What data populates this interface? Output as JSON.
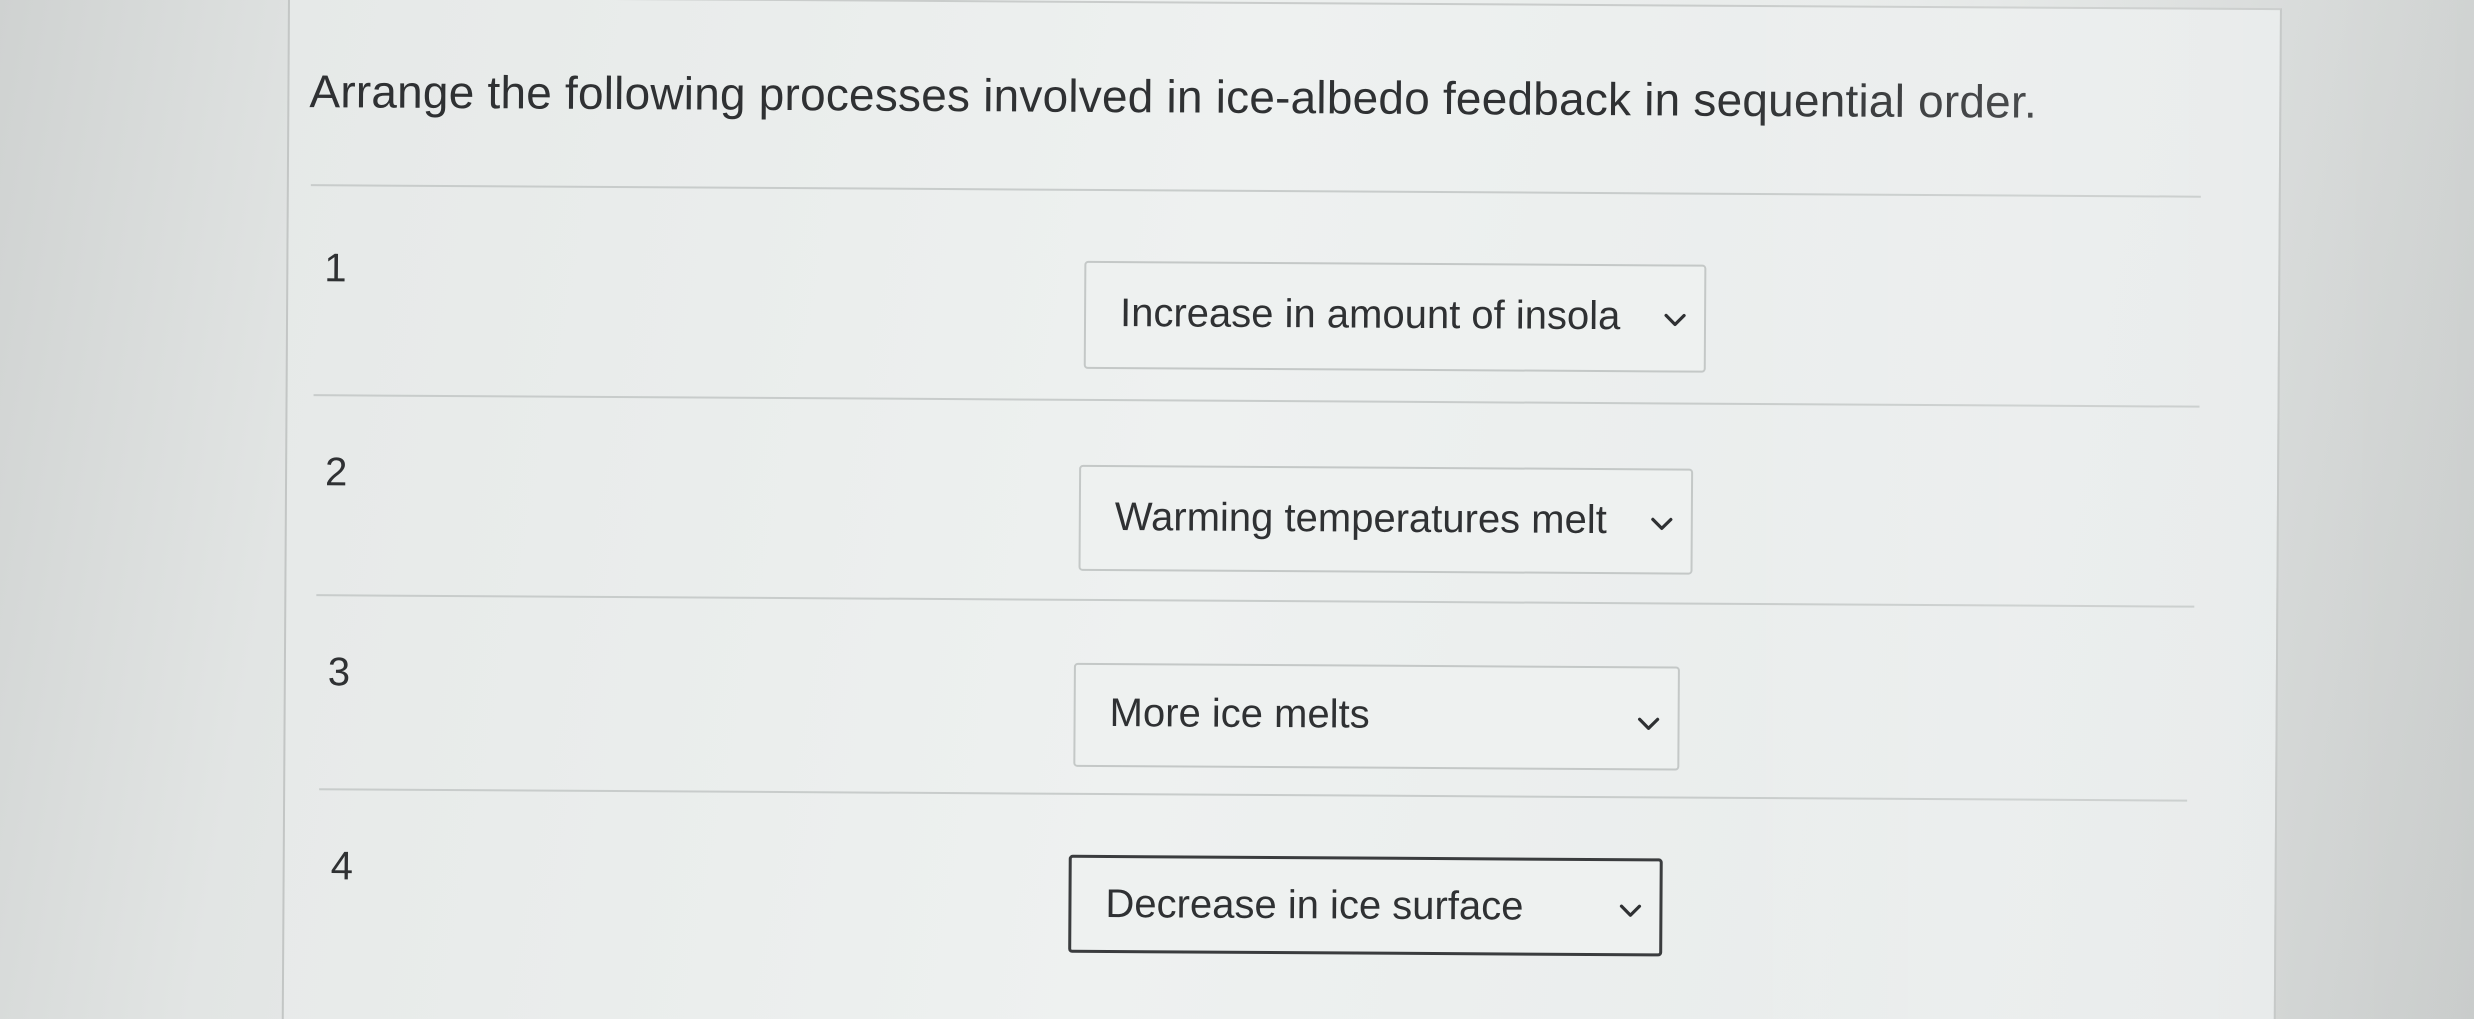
{
  "question": "Arrange the following processes involved in ice-albedo feedback in sequential order.",
  "rows": [
    {
      "number": "1",
      "selected": "Increase in amount of insola"
    },
    {
      "number": "2",
      "selected": "Warming temperatures melt"
    },
    {
      "number": "3",
      "selected": "More ice melts"
    },
    {
      "number": "4",
      "selected": "Decrease in ice surface"
    }
  ]
}
